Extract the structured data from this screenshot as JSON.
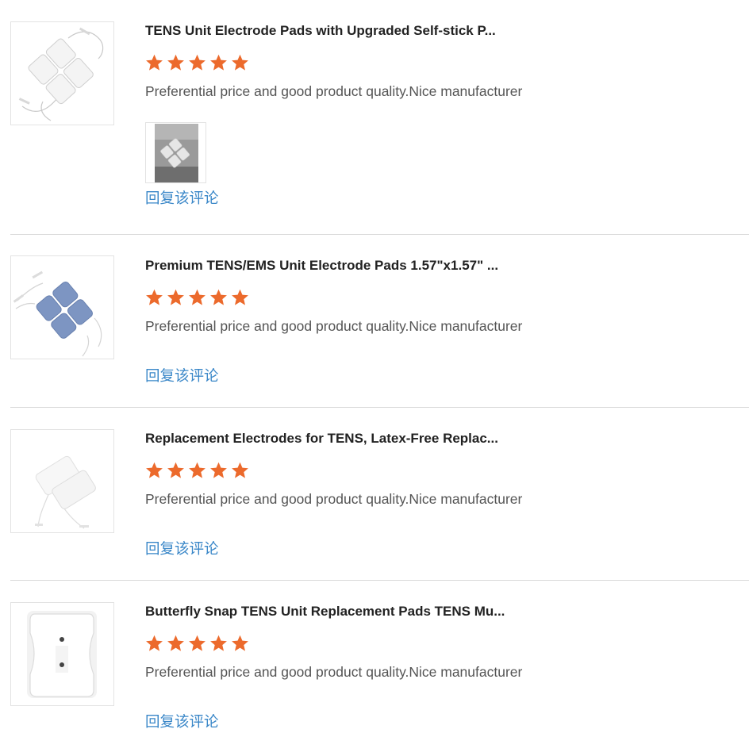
{
  "colors": {
    "star": "#ec6a2c",
    "link": "#3a87c8",
    "divider": "#d9d9d9"
  },
  "reviews": [
    {
      "title": "TENS Unit Electrode Pads with Upgraded Self-stick P...",
      "rating": 5,
      "comment": "Preferential price and good product quality.Nice manufacturer",
      "reply_label": "回复该评论",
      "thumbnail_icon": "white-square-electrode-pads-image",
      "has_photo": true
    },
    {
      "title": "Premium TENS/EMS Unit Electrode Pads 1.57\"x1.57\" ...",
      "rating": 5,
      "comment": "Preferential price and good product quality.Nice manufacturer",
      "reply_label": "回复该评论",
      "thumbnail_icon": "blue-electrode-pads-image",
      "has_photo": false
    },
    {
      "title": "Replacement Electrodes for TENS, Latex-Free Replac...",
      "rating": 5,
      "comment": "Preferential price and good product quality.Nice manufacturer",
      "reply_label": "回复该评论",
      "thumbnail_icon": "rectangular-electrode-pads-image",
      "has_photo": false
    },
    {
      "title": "Butterfly Snap TENS Unit Replacement Pads TENS Mu...",
      "rating": 5,
      "comment": "Preferential price and good product quality.Nice manufacturer",
      "reply_label": "回复该评论",
      "thumbnail_icon": "butterfly-snap-pad-image",
      "has_photo": false
    }
  ]
}
